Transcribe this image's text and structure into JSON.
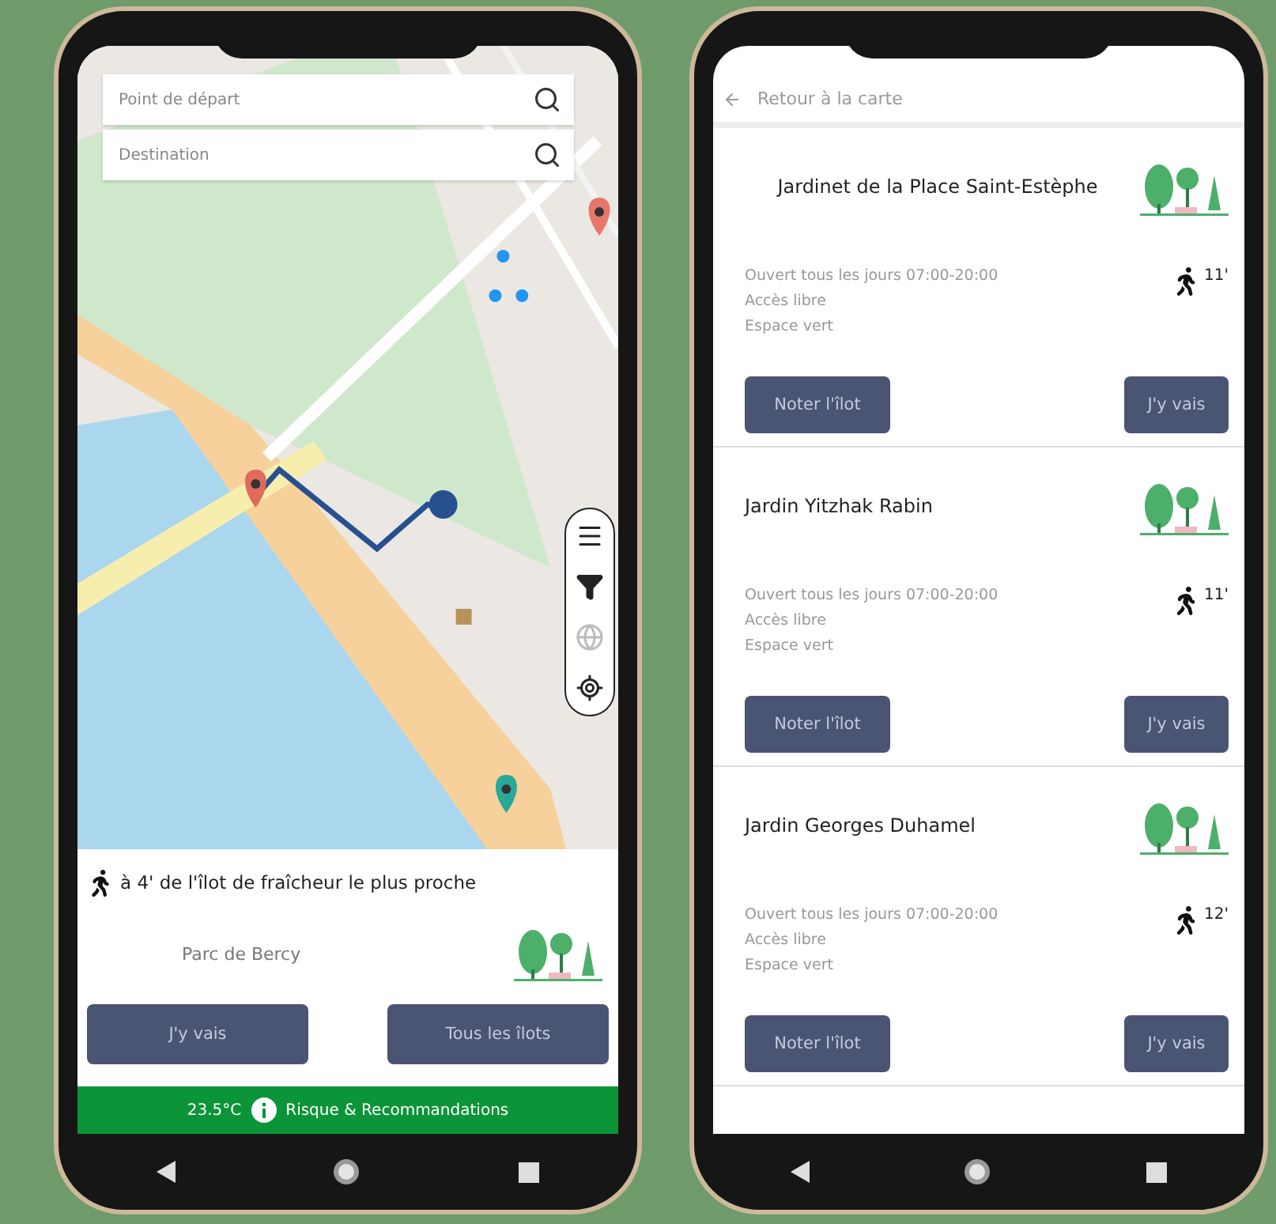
{
  "map_screen": {
    "search_fields": [
      {
        "placeholder": "Point de départ"
      },
      {
        "placeholder": "Destination"
      }
    ],
    "nearest": "à 4' de l'îlot de fraîcheur le plus proche",
    "park_name": "Parc de Bercy",
    "buttons": [
      "J'y vais",
      "Tous les îlots"
    ],
    "footer": {
      "temperature": "23.5°C",
      "label": "Risque & Recommandations"
    }
  },
  "list_screen": {
    "back_link": "Retour à la carte",
    "spots": [
      {
        "name": "Jardinet de la Place Saint-Estèphe",
        "centered": true,
        "details": [
          "Ouvert tous les jours 07:00-20:00",
          "Accès libre",
          "Espace vert"
        ],
        "walk_time": "11'",
        "buttons": [
          "Noter l'îlot",
          "J'y vais"
        ]
      },
      {
        "name": "Jardin Yitzhak Rabin",
        "centered": false,
        "details": [
          "Ouvert tous les jours 07:00-20:00",
          "Accès libre",
          "Espace vert"
        ],
        "walk_time": "11'",
        "buttons": [
          "Noter l'îlot",
          "J'y vais"
        ]
      },
      {
        "name": "Jardin Georges Duhamel",
        "centered": false,
        "details": [
          "Ouvert tous les jours 07:00-20:00",
          "Accès libre",
          "Espace vert"
        ],
        "walk_time": "12'",
        "buttons": [
          "Noter l'îlot",
          "J'y vais"
        ]
      }
    ]
  }
}
